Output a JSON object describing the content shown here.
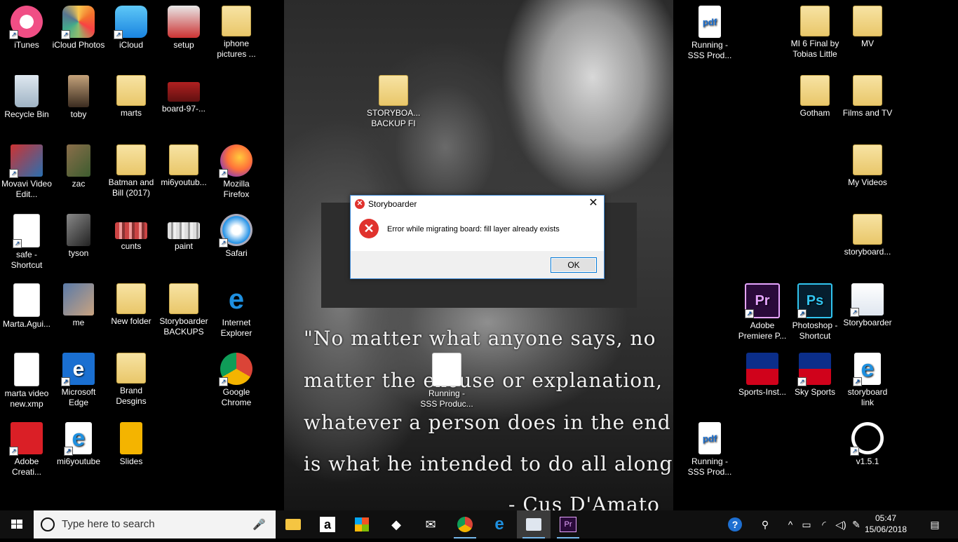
{
  "desktop": {
    "icons": [
      {
        "label": "iTunes",
        "kind": "itunes"
      },
      {
        "label": "iCloud Photos",
        "kind": "photos"
      },
      {
        "label": "iCloud",
        "kind": "icloud"
      },
      {
        "label": "setup",
        "kind": "setup"
      },
      {
        "label": "iphone pictures ...",
        "kind": "folder"
      },
      {
        "label": "Recycle Bin",
        "kind": "recycle"
      },
      {
        "label": "toby",
        "kind": "photo"
      },
      {
        "label": "marts",
        "kind": "folder"
      },
      {
        "label": "board-97-...",
        "kind": "image"
      },
      {
        "label": "Movavi Video Edit...",
        "kind": "movavi"
      },
      {
        "label": "zac",
        "kind": "photo"
      },
      {
        "label": "Batman and Bill (2017)",
        "kind": "folder"
      },
      {
        "label": "mi6youtub...",
        "kind": "folder"
      },
      {
        "label": "Mozilla Firefox",
        "kind": "firefox"
      },
      {
        "label": "safe - Shortcut",
        "kind": "safe"
      },
      {
        "label": "tyson",
        "kind": "photo"
      },
      {
        "label": "cunts",
        "kind": "image"
      },
      {
        "label": "paint",
        "kind": "image"
      },
      {
        "label": "Safari",
        "kind": "safari"
      },
      {
        "label": "Marta.Agui...",
        "kind": "video"
      },
      {
        "label": "me",
        "kind": "photo"
      },
      {
        "label": "New folder",
        "kind": "folder"
      },
      {
        "label": "Storyboarder BACKUPS",
        "kind": "folder"
      },
      {
        "label": "Internet Explorer",
        "kind": "ie"
      },
      {
        "label": "marta video new.xmp",
        "kind": "file"
      },
      {
        "label": "Microsoft Edge",
        "kind": "edge"
      },
      {
        "label": "Brand Desgins",
        "kind": "folder"
      },
      {
        "label": "Google Chrome",
        "kind": "chrome"
      },
      {
        "label": "Adobe Creati...",
        "kind": "adobe"
      },
      {
        "label": "mi6youtube",
        "kind": "ie"
      },
      {
        "label": "Slides",
        "kind": "slides"
      },
      {
        "label": "STORYBOA... BACKUP FI",
        "kind": "folder"
      },
      {
        "label": "Running - SSS Produc...",
        "kind": "storyboarder-file"
      },
      {
        "label": "Running - SSS Prod...",
        "kind": "pdf"
      },
      {
        "label": "MI 6 Final by Tobias Little",
        "kind": "folder"
      },
      {
        "label": "MV",
        "kind": "folder"
      },
      {
        "label": "Gotham",
        "kind": "folder"
      },
      {
        "label": "Films and TV",
        "kind": "folder"
      },
      {
        "label": "My Videos",
        "kind": "folder"
      },
      {
        "label": "storyboard...",
        "kind": "folder"
      },
      {
        "label": "Adobe Premiere P...",
        "kind": "premiere"
      },
      {
        "label": "Photoshop - Shortcut",
        "kind": "photoshop"
      },
      {
        "label": "Storyboarder",
        "kind": "storyboarder"
      },
      {
        "label": "Sports-Inst...",
        "kind": "sky"
      },
      {
        "label": "Sky Sports",
        "kind": "sky"
      },
      {
        "label": "storyboard link",
        "kind": "ie"
      },
      {
        "label": "Running - SSS Prod...",
        "kind": "pdf"
      },
      {
        "label": "v1.5.1",
        "kind": "github"
      }
    ],
    "wallpaper_quote": [
      "\"No matter what anyone says, no",
      "matter the excuse or explanation,",
      "whatever a person does in the end",
      "is what he intended to do all along.\"",
      "- Cus D'Amato"
    ]
  },
  "dialog": {
    "title": "Storyboarder",
    "message": "Error while migrating board: fill layer already exists",
    "ok_label": "OK",
    "close_glyph": "✕"
  },
  "taskbar": {
    "search_placeholder": "Type here to search",
    "time": "05:47",
    "date": "15/06/2018",
    "apps": [
      "File Explorer",
      "Amazon",
      "Microsoft Store",
      "Dropbox",
      "Mail",
      "Google Chrome",
      "Microsoft Edge",
      "Storyboarder",
      "Adobe Premiere Pro"
    ]
  },
  "colors": {
    "accent": "#0078d7",
    "error": "#e0322d",
    "taskbar": "#101010"
  }
}
